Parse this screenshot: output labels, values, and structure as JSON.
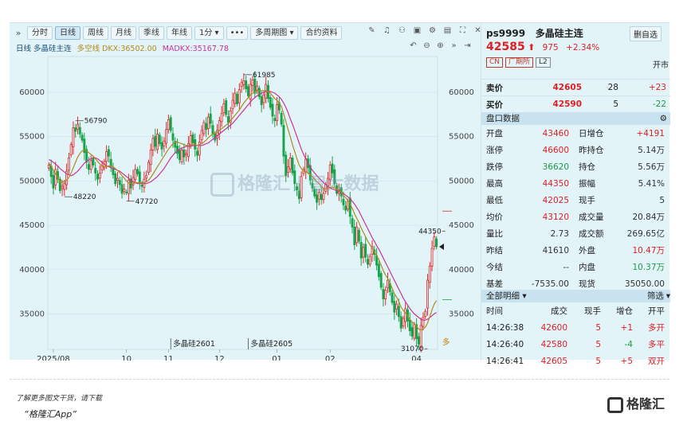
{
  "toolbar": {
    "expand": "»",
    "buttons": [
      "分时",
      "日线",
      "周线",
      "月线",
      "季线",
      "年线",
      "1分 ▾",
      "•••",
      "多周期图 ▾",
      "合约资料"
    ],
    "active_index": 1
  },
  "legend": {
    "name": "日线 多晶硅主连",
    "dk": "多空线 DKX:36502.00",
    "madk": "MADKX:35167.78",
    "dk_color": "#b08a1a",
    "madk_color": "#c8349a"
  },
  "chart_data": {
    "type": "candlestick",
    "y_ticks": [
      35000,
      40000,
      45000,
      50000,
      55000,
      60000
    ],
    "ylim": [
      31000,
      63500
    ],
    "x_ticks": [
      "2025/08",
      "10",
      "11",
      "12",
      "01",
      "02",
      "04"
    ],
    "x_tick_index": [
      2,
      35,
      54,
      77,
      103,
      127,
      166
    ],
    "annotations": [
      {
        "text": "61985",
        "index": 88,
        "value": 61985
      },
      {
        "text": "56790",
        "index": 12,
        "value": 56790
      },
      {
        "text": "48220",
        "index": 7,
        "value": 48220
      },
      {
        "text": "47720",
        "index": 35,
        "value": 47720
      },
      {
        "text": "44350",
        "index": 179,
        "value": 44350
      },
      {
        "text": "31070",
        "index": 171,
        "value": 31070
      }
    ],
    "contract_labels": [
      "多晶硅2601",
      "多晶硅2605"
    ],
    "right_label": "多",
    "closes": [
      51800,
      50500,
      49200,
      51300,
      50200,
      48900,
      49400,
      49700,
      51100,
      52600,
      54100,
      56000,
      55600,
      56400,
      55300,
      54600,
      53200,
      52100,
      51300,
      52300,
      51800,
      50900,
      50200,
      50900,
      51700,
      52200,
      53300,
      52800,
      51600,
      50700,
      49700,
      50300,
      49600,
      48600,
      49100,
      48700,
      50100,
      49200,
      50400,
      51300,
      50800,
      49900,
      49400,
      50200,
      50600,
      52100,
      53500,
      54800,
      53900,
      55300,
      54200,
      53600,
      54500,
      55800,
      56900,
      55700,
      54600,
      53800,
      53100,
      52400,
      53500,
      52700,
      53100,
      54200,
      55100,
      54300,
      53600,
      52900,
      54400,
      55700,
      56600,
      55800,
      57200,
      56500,
      55300,
      54600,
      55700,
      56800,
      57600,
      58700,
      57500,
      56600,
      57900,
      59100,
      59900,
      58700,
      60300,
      61100,
      61300,
      60400,
      59600,
      60900,
      61400,
      59900,
      60700,
      59500,
      58600,
      59700,
      60900,
      59300,
      58300,
      57300,
      56800,
      58600,
      58000,
      56400,
      52800,
      50600,
      51600,
      52600,
      50900,
      49700,
      49000,
      48000,
      50500,
      51300,
      52500,
      51500,
      50100,
      49200,
      48300,
      47600,
      48700,
      47900,
      48600,
      49600,
      50300,
      51800,
      50900,
      49700,
      48600,
      49000,
      48300,
      47300,
      46700,
      47700,
      46000,
      44800,
      42800,
      44800,
      43200,
      41300,
      42500,
      41400,
      40600,
      41500,
      42600,
      41700,
      40500,
      39200,
      38000,
      36700,
      37700,
      38800,
      37500,
      36300,
      35200,
      36100,
      34700,
      33400,
      34500,
      35600,
      34200,
      33100,
      32500,
      33800,
      32200,
      31600,
      33700,
      34600,
      35300,
      38800,
      40400,
      42400,
      43700,
      42585
    ],
    "dkx": [
      52000,
      51700,
      51200,
      50800,
      50400,
      49900,
      49900,
      49900,
      50100,
      50400,
      50900,
      51500,
      52100,
      52700,
      53100,
      53400,
      53500,
      53400,
      53200,
      53000,
      52800,
      52500,
      52200,
      51900,
      51700,
      51600,
      51600,
      51700,
      51700,
      51600,
      51400,
      51200,
      50900,
      50600,
      50300,
      50000,
      49800,
      49700,
      49700,
      49800,
      49800,
      49800,
      49800,
      49800,
      49900,
      50100,
      50400,
      50800,
      51200,
      51600,
      52000,
      52400,
      52800,
      53200,
      53600,
      53900,
      54200,
      54400,
      54400,
      54300,
      54200,
      54100,
      54000,
      54000,
      54000,
      54100,
      54100,
      54000,
      54100,
      54200,
      54400,
      54600,
      54900,
      55100,
      55300,
      55400,
      55500,
      55700,
      55900,
      56100,
      56300,
      56500,
      56800,
      57100,
      57400,
      57700,
      58000,
      58400,
      58800,
      59100,
      59400,
      59700,
      59900,
      60000,
      60200,
      60200,
      60200,
      60200,
      60200,
      60100,
      59900,
      59600,
      59300,
      59100,
      58800,
      58400,
      57600,
      56700,
      55800,
      55000,
      54100,
      53300,
      52500,
      51800,
      51400,
      51100,
      51000,
      50900,
      50700,
      50500,
      50200,
      49900,
      49700,
      49400,
      49200,
      49100,
      49200,
      49300,
      49300,
      49200,
      49100,
      48900,
      48700,
      48400,
      48100,
      47800,
      47400,
      46900,
      46300,
      45800,
      45300,
      44700,
      44200,
      43700,
      43200,
      42800,
      42400,
      42000,
      41600,
      41100,
      40500,
      39900,
      39400,
      39000,
      38500,
      37900,
      37300,
      36900,
      36400,
      35800,
      35400,
      35100,
      34800,
      34400,
      34100,
      33900,
      33600,
      33300,
      33200,
      33300,
      33500,
      34000,
      34700,
      35500,
      36100,
      36502
    ],
    "madkx": [
      52400,
      52300,
      52100,
      51900,
      51700,
      51400,
      51200,
      51000,
      50800,
      50700,
      50600,
      50700,
      50900,
      51100,
      51400,
      51700,
      52000,
      52200,
      52400,
      52500,
      52600,
      52600,
      52500,
      52300,
      52100,
      51900,
      51700,
      51600,
      51500,
      51400,
      51300,
      51200,
      51100,
      50900,
      50700,
      50500,
      50300,
      50100,
      49900,
      49800,
      49700,
      49700,
      49700,
      49700,
      49700,
      49800,
      49900,
      50100,
      50300,
      50500,
      50800,
      51100,
      51400,
      51800,
      52200,
      52600,
      52900,
      53200,
      53400,
      53600,
      53700,
      53800,
      53900,
      53900,
      53900,
      54000,
      54000,
      54000,
      54000,
      54000,
      54100,
      54200,
      54300,
      54500,
      54700,
      54900,
      55100,
      55300,
      55500,
      55700,
      55900,
      56100,
      56300,
      56500,
      56800,
      57100,
      57400,
      57700,
      58000,
      58300,
      58600,
      58900,
      59200,
      59400,
      59600,
      59800,
      59900,
      60000,
      60100,
      60100,
      60100,
      60000,
      59900,
      59700,
      59500,
      59200,
      58800,
      58300,
      57700,
      57000,
      56400,
      55700,
      55000,
      54300,
      53600,
      53000,
      52500,
      52000,
      51600,
      51200,
      50900,
      50600,
      50300,
      50100,
      49800,
      49600,
      49400,
      49200,
      49100,
      49000,
      48900,
      48800,
      48700,
      48600,
      48400,
      48200,
      48000,
      47700,
      47400,
      47000,
      46600,
      46100,
      45600,
      45100,
      44600,
      44100,
      43600,
      43200,
      42700,
      42300,
      41800,
      41300,
      40800,
      40300,
      39800,
      39300,
      38800,
      38300,
      37800,
      37300,
      36800,
      36400,
      36000,
      35600,
      35300,
      35000,
      34800,
      34600,
      34400,
      34300,
      34300,
      34400,
      34600,
      34800,
      35000,
      35167
    ]
  },
  "panel": {
    "symbol": "ps9999",
    "name": "多晶硅主连",
    "button": "删自选",
    "price": "42585",
    "arrow": "⬆",
    "change": "975",
    "change_pct": "+2.34%",
    "tags": [
      "CN",
      "广期所",
      "L2"
    ],
    "open_label": "开市",
    "orderbook": [
      {
        "label": "卖价",
        "price": "42605",
        "vol": "28",
        "diff": "+23"
      },
      {
        "label": "买价",
        "price": "42590",
        "vol": "5",
        "diff": "-22"
      }
    ],
    "section1": "盘口数据",
    "stats": [
      {
        "l1": "开盘",
        "v1": "43460",
        "c1": "red",
        "l2": "日增仓",
        "v2": "+4191",
        "c2": "red"
      },
      {
        "l1": "涨停",
        "v1": "46600",
        "c1": "red",
        "l2": "昨持仓",
        "v2": "5.14万",
        "c2": "dark"
      },
      {
        "l1": "跌停",
        "v1": "36620",
        "c1": "green",
        "l2": "持仓",
        "v2": "5.56万",
        "c2": "dark"
      },
      {
        "l1": "最高",
        "v1": "44350",
        "c1": "red",
        "l2": "振幅",
        "v2": "5.41%",
        "c2": "dark"
      },
      {
        "l1": "最低",
        "v1": "42025",
        "c1": "red",
        "l2": "现手",
        "v2": "5",
        "c2": "dark"
      },
      {
        "l1": "均价",
        "v1": "43120",
        "c1": "red",
        "l2": "成交量",
        "v2": "20.84万",
        "c2": "dark"
      },
      {
        "l1": "量比",
        "v1": "2.73",
        "c1": "dark",
        "l2": "成交额",
        "v2": "269.65亿",
        "c2": "dark"
      },
      {
        "l1": "昨结",
        "v1": "41610",
        "c1": "dark",
        "l2": "外盘",
        "v2": "10.47万",
        "c2": "red"
      },
      {
        "l1": "今结",
        "v1": "--",
        "c1": "dark",
        "l2": "内盘",
        "v2": "10.37万",
        "c2": "green"
      },
      {
        "l1": "基差",
        "v1": "-7535.00",
        "c1": "dark",
        "l2": "现货",
        "v2": "35050.00",
        "c2": "dark"
      }
    ],
    "section2": "全部明细",
    "filter": "筛选",
    "trade_headers": [
      "时间",
      "成交",
      "现手",
      "增仓",
      "开平"
    ],
    "trades": [
      {
        "time": "14:26:38",
        "price": "42600",
        "vol": "5",
        "inc": "+1",
        "type": "多开",
        "pc": "red",
        "ic": "red",
        "tc": "red"
      },
      {
        "time": "14:26:40",
        "price": "42580",
        "vol": "5",
        "inc": "-4",
        "type": "多平",
        "pc": "red",
        "ic": "green",
        "tc": "red"
      },
      {
        "time": "14:26:41",
        "price": "42605",
        "vol": "5",
        "inc": "+5",
        "type": "双开",
        "pc": "red",
        "ic": "red",
        "tc": "red"
      }
    ]
  },
  "footer": {
    "line1": "了解更多图文干货，请下载",
    "line2": "“格隆汇App”",
    "logo": "格隆汇",
    "watermark": "格隆汇 | 智大数据"
  }
}
